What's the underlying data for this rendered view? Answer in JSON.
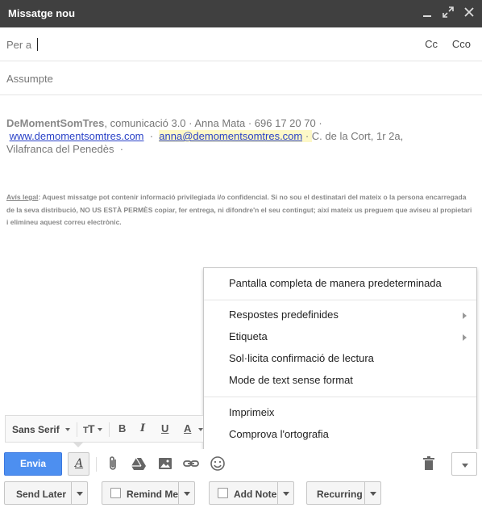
{
  "window": {
    "title": "Missatge nou"
  },
  "to": {
    "label": "Per a",
    "cc_label": "Cc",
    "bcc_label": "Cco"
  },
  "subject": {
    "placeholder": "Assumpte"
  },
  "signature": {
    "brand": "DeMomentSomTres",
    "line1_rest": ", comunicació 3.0 ·  Anna Mata  ·  696 17 20 70  ·",
    "website": "www.demomentsomtres.com",
    "sep": "  ·  ",
    "email": "anna@demomentsomtres.com",
    "dot": " · ",
    "address": "C. de la Cort, 1r 2a,",
    "city": "Vilafranca del Penedès  ·"
  },
  "legal": {
    "title": "Avís legal",
    "text": ": Aquest missatge pot contenir informació privilegiada i/o confidencial. Si no sou el destinatari del mateix o la persona encarregada de la seva distribució, NO US ESTÀ PERMÈS copiar, fer entrega, ni difondre'n el seu contingut; així mateix us preguem que aviseu al propietari i elimineu aquest correu electrònic."
  },
  "menu": {
    "items": [
      "Pantalla completa de manera predeterminada",
      "Respostes predefinides",
      "Etiqueta",
      "Sol·licita confirmació de lectura",
      "Mode de text sense format",
      "Imprimeix",
      "Comprova l'ortografia"
    ]
  },
  "format_bar": {
    "font": "Sans Serif",
    "bold": "B",
    "italic": "I",
    "underline": "U",
    "color": "A"
  },
  "toolbar": {
    "send_label": "Envia",
    "format_icon": "A"
  },
  "addons": {
    "send_later": "Send Later",
    "remind_me": "Remind Me",
    "add_note": "Add Note",
    "recurring": "Recurring"
  },
  "colors": {
    "titlebar": "#404040",
    "send": "#4d8ff0",
    "link": "#2a42c8"
  }
}
